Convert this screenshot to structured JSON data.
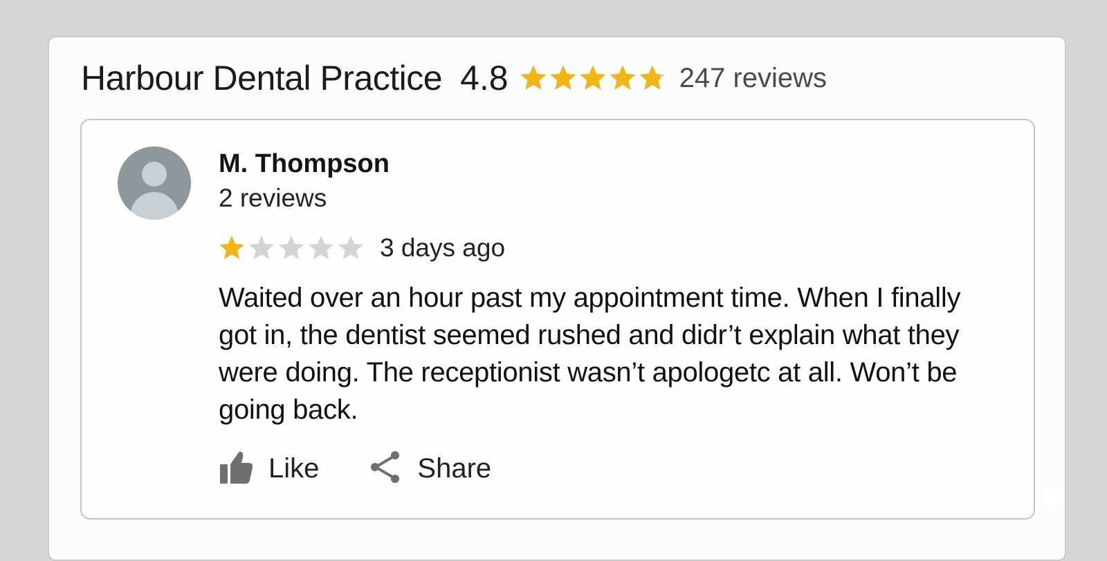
{
  "business": {
    "name": "Harbour Dental Practice",
    "rating": "4.8",
    "rating_value": 4.8,
    "max_stars": 5,
    "review_count": "247 reviews"
  },
  "review": {
    "author": "M. Thompson",
    "author_reviews": "2 reviews",
    "stars": 1,
    "max_stars": 5,
    "time_ago": "3 days ago",
    "text": "Waited over an hour past my appointment time. When I finally got in, the dentist seemed rushed and didr’t explain what they were doing. The receptionist wasn’t apologetc at all. Won’t be going back."
  },
  "actions": {
    "like_label": "Like",
    "share_label": "Share"
  },
  "colors": {
    "star_filled": "#f2b516",
    "star_empty": "#d4d4d4",
    "icon_gray": "#6d6f70",
    "avatar_bg": "#8e979c"
  },
  "icons": {
    "star": "star-icon",
    "like": "thumbs-up-icon",
    "share": "share-icon",
    "avatar": "person-icon"
  }
}
